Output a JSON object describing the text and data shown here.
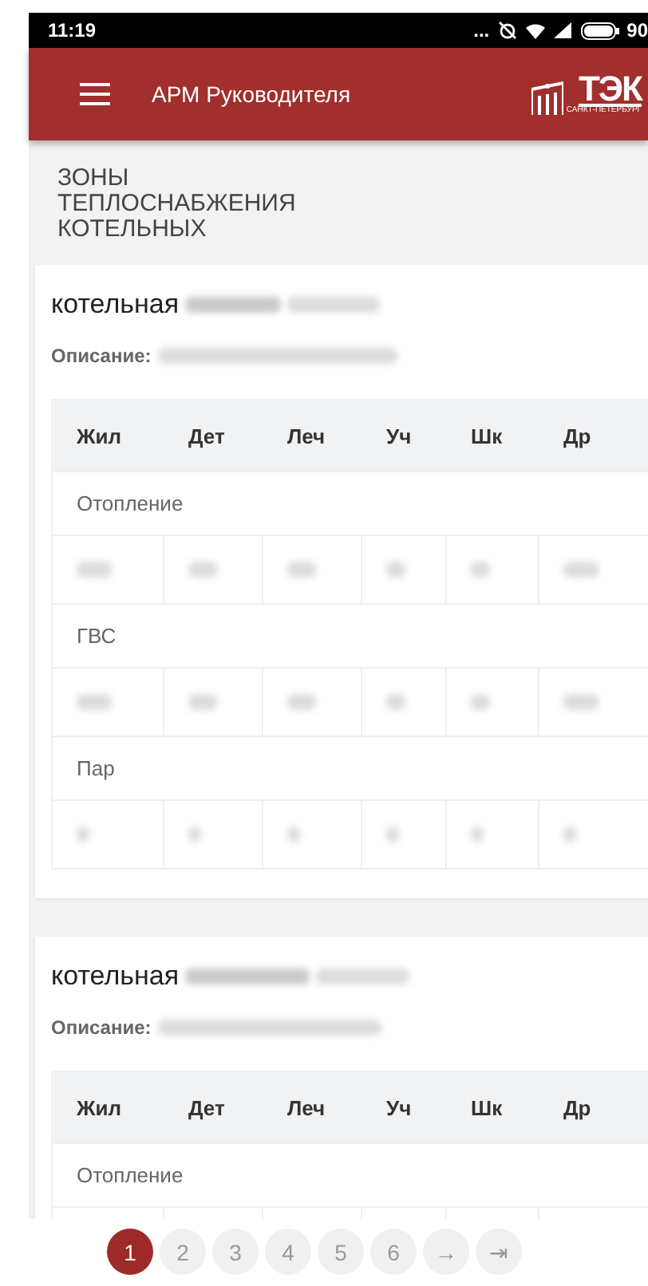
{
  "status_bar": {
    "time": "11:19",
    "dots": "...",
    "battery": "90"
  },
  "header": {
    "title": "АРМ Руководителя",
    "logo_text": "ТЭК",
    "logo_subtext": "САНКТ-ПЕТЕРБУРГ"
  },
  "page_title": "ЗОНЫ ТЕПЛОСНАБЖЕНИЯ КОТЕЛЬНЫХ",
  "cards": [
    {
      "title": "котельная",
      "description_label": "Описание:",
      "columns": [
        "Жил",
        "Дет",
        "Леч",
        "Уч",
        "Шк",
        "Др"
      ],
      "sections": [
        {
          "label": "Отопление"
        },
        {
          "label": "ГВС"
        },
        {
          "label": "Пар"
        }
      ]
    },
    {
      "title": "котельная",
      "description_label": "Описание:",
      "columns": [
        "Жил",
        "Дет",
        "Леч",
        "Уч",
        "Шк",
        "Др"
      ],
      "sections": [
        {
          "label": "Отопление"
        }
      ]
    }
  ],
  "pagination": [
    {
      "label": "1",
      "selected": true
    },
    {
      "label": "2",
      "selected": false
    },
    {
      "label": "3",
      "selected": false
    },
    {
      "label": "4",
      "selected": false
    },
    {
      "label": "5",
      "selected": false
    },
    {
      "label": "6",
      "selected": false
    },
    {
      "label": "→",
      "selected": false
    },
    {
      "label": "⇥",
      "selected": false
    }
  ]
}
